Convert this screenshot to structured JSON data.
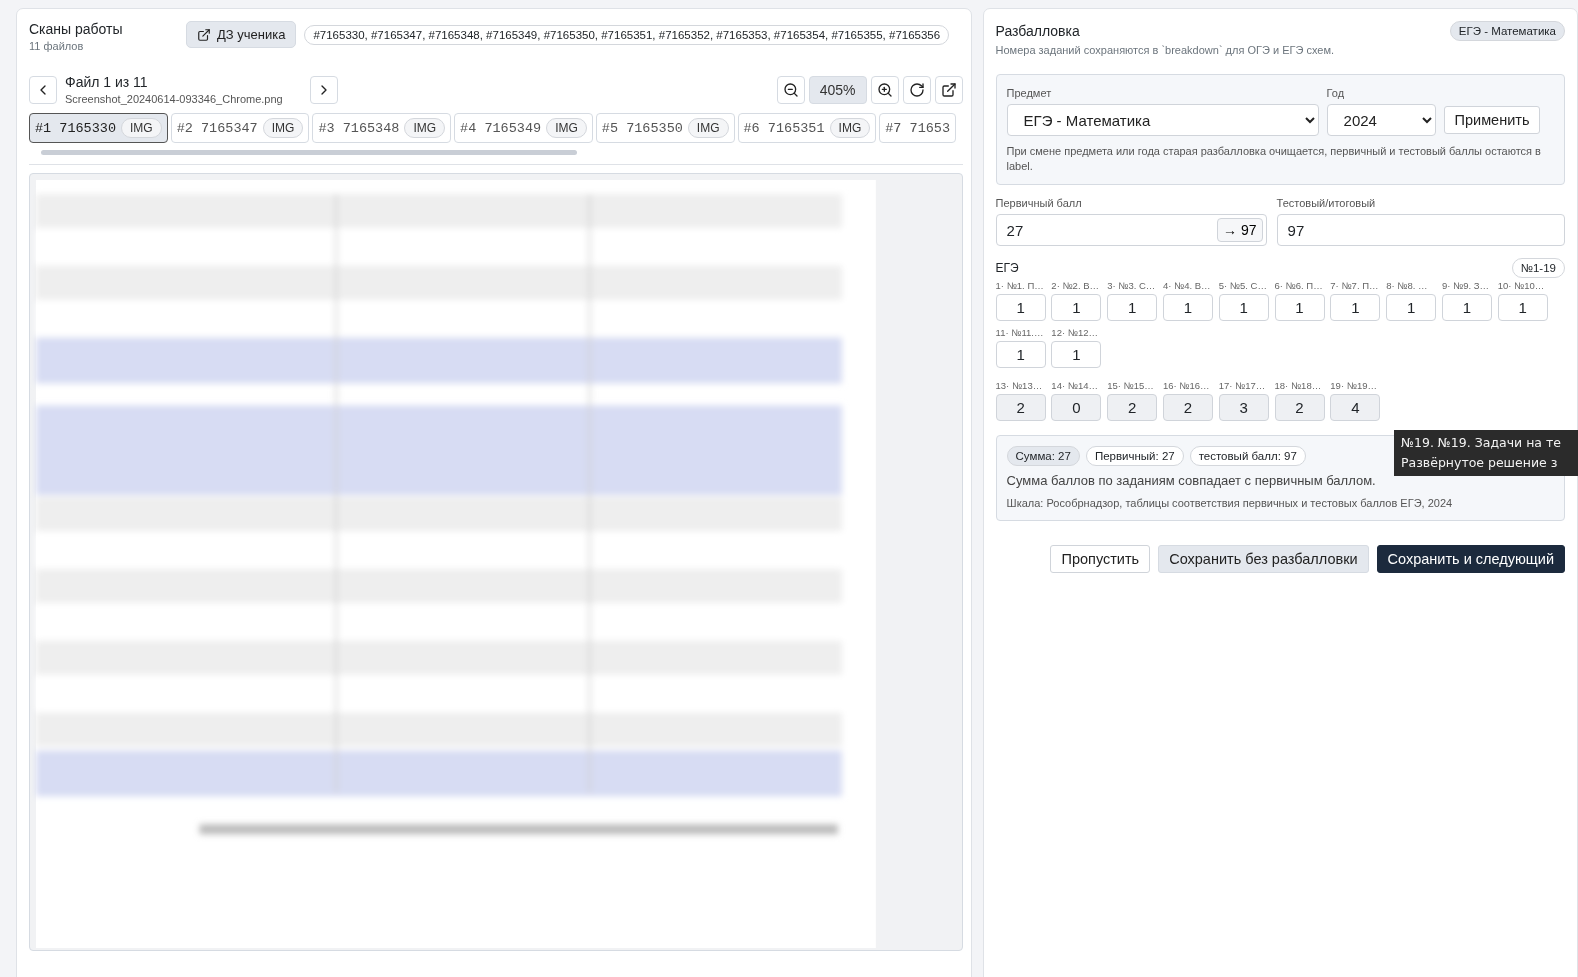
{
  "scans": {
    "title": "Сканы работы",
    "subtitle": "11 файлов",
    "student_button": "ДЗ ученика",
    "ids": "#7165330, #7165347, #7165348, #7165349, #7165350, #7165351, #7165352, #7165353, #7165354, #7165355, #7165356",
    "file_title": "Файл 1 из 11",
    "file_name": "Screenshot_20240614-093346_Chrome.png",
    "zoom": "405%",
    "files": [
      {
        "num": "#1",
        "id": "7165330",
        "type": "IMG",
        "selected": true
      },
      {
        "num": "#2",
        "id": "7165347",
        "type": "IMG",
        "selected": false
      },
      {
        "num": "#3",
        "id": "7165348",
        "type": "IMG",
        "selected": false
      },
      {
        "num": "#4",
        "id": "7165349",
        "type": "IMG",
        "selected": false
      },
      {
        "num": "#5",
        "id": "7165350",
        "type": "IMG",
        "selected": false
      },
      {
        "num": "#6",
        "id": "7165351",
        "type": "IMG",
        "selected": false
      },
      {
        "num": "#7",
        "id": "71653",
        "selected": false
      }
    ]
  },
  "breakdown": {
    "title": "Разбалловка",
    "badge": "ЕГЭ - Математика",
    "subtitle": "Номера заданий сохраняются в `breakdown` для ОГЭ и ЕГЭ схем.",
    "subject_label": "Предмет",
    "subject": "ЕГЭ - Математика",
    "year_label": "Год",
    "year": "2024",
    "apply": "Применить",
    "note": "При смене предмета или года старая разбалловка очищается, первичный и тестовый баллы остаются в label.",
    "primary_label": "Первичный балл",
    "primary": "27",
    "convert": "→ 97",
    "test_label": "Тестовый/итоговый",
    "test": "97",
    "section": "ЕГЭ",
    "range": "№1-19",
    "groups": [
      {
        "kind": "short",
        "tasks": [
          {
            "label": "1· №1. П…",
            "value": "1"
          },
          {
            "label": "2· №2. В…",
            "value": "1"
          },
          {
            "label": "3· №3. С…",
            "value": "1"
          },
          {
            "label": "4· №4. В…",
            "value": "1"
          },
          {
            "label": "5· №5. С…",
            "value": "1"
          },
          {
            "label": "6· №6. П…",
            "value": "1"
          },
          {
            "label": "7· №7. П…",
            "value": "1"
          },
          {
            "label": "8· №8. …",
            "value": "1"
          },
          {
            "label": "9· №9. З…",
            "value": "1"
          },
          {
            "label": "10· №10…",
            "value": "1"
          },
          {
            "label": "11· №11.…",
            "value": "1"
          },
          {
            "label": "12· №12…",
            "value": "1"
          }
        ]
      },
      {
        "kind": "long",
        "tasks": [
          {
            "label": "13· №13…",
            "value": "2"
          },
          {
            "label": "14· №14…",
            "value": "0"
          },
          {
            "label": "15· №15…",
            "value": "2"
          },
          {
            "label": "16· №16…",
            "value": "2"
          },
          {
            "label": "17· №17…",
            "value": "3"
          },
          {
            "label": "18· №18…",
            "value": "2"
          },
          {
            "label": "19· №19…",
            "value": "4"
          }
        ]
      }
    ],
    "chips": [
      {
        "text": "Сумма: 27",
        "selected": true
      },
      {
        "text": "Первичный: 27",
        "selected": false
      },
      {
        "text": "тестовый балл: 97",
        "selected": false
      }
    ],
    "match": "Сумма баллов по заданиям совпадает с первичным баллом.",
    "scale": "Шкала: Рособрнадзор, таблицы соответствия первичных и тестовых баллов ЕГЭ, 2024",
    "tooltip": [
      "№19. №19. Задачи на те",
      "Развёрнутое решение з"
    ],
    "buttons": [
      {
        "label": "Пропустить",
        "kind": "outline"
      },
      {
        "label": "Сохранить без разбалловки",
        "kind": "muted"
      },
      {
        "label": "Сохранить и следующий",
        "kind": "primary"
      }
    ]
  }
}
